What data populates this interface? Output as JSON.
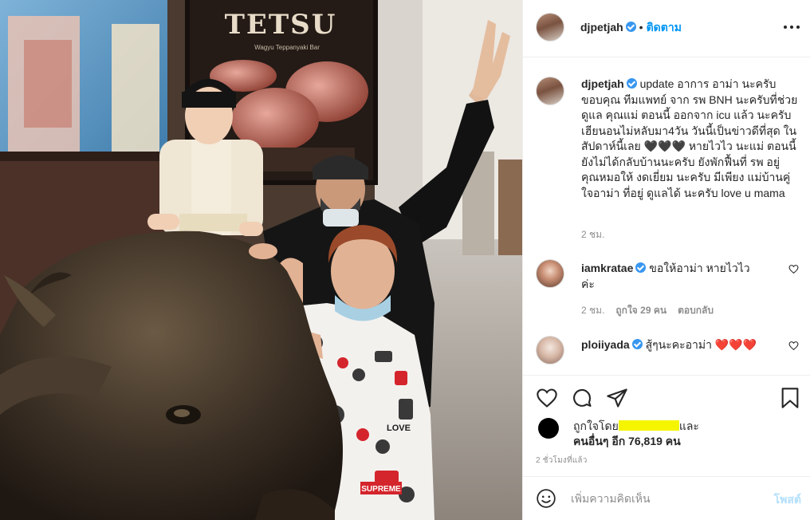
{
  "post": {
    "username": "djpetjah",
    "verified": true,
    "separator": "•",
    "follow_label": "ติดตาม"
  },
  "caption": {
    "username": "djpetjah",
    "text": "update อาการ อาม่า นะครับ ขอบคุณ ทีมแพทย์ จาก รพ BNH นะครับที่ช่วยดูแล คุณแม่ ตอนนี้ ออกจาก icu แล้ว นะครับ เฮียนอนไม่หลับมา4วัน วันนี้เป็นข่าวดีที่สุด ในสัปดาห์นี้เลย 🖤🖤🖤 หายไวไว นะแม่ ตอนนี้ยังไม่ได้กลับบ้านนะครับ ยังพักฟื้นที่ รพ อยู่ คุณหมอให้ งดเยี่ยม นะครับ มีเพียง แม่บ้านคู่ใจอาม่า ที่อยู่ ดูแลได้ นะครับ love u mama",
    "time": "2 ชม."
  },
  "comments": [
    {
      "username": "iamkratae",
      "verified": true,
      "text": "ขอให้อาม่า หายไวไวค่ะ",
      "time": "2 ชม.",
      "likes": "ถูกใจ 29 คน",
      "reply": "ตอบกลับ"
    },
    {
      "username": "ploiiyada",
      "verified": true,
      "text": "สู้ๆนะคะอาม่า",
      "hearts": "❤️❤️❤️"
    }
  ],
  "likes": {
    "prefix": "ถูกใจโดย",
    "suffix": "และ",
    "others": "คนอื่นๆ อีก 76,819 คน"
  },
  "post_time": "2 ชั่วโมงที่แล้ว",
  "add_comment": {
    "placeholder": "เพิ่มความคิดเห็น",
    "post_label": "โพสต์"
  },
  "photo": {
    "sign_text": "TETSU",
    "sign_sub": "Wagyu Teppanyaki Bar",
    "sweater_texts": [
      "SUPREME",
      "LOVE"
    ]
  },
  "colors": {
    "accent": "#0095f6",
    "verified": "#3897f0",
    "heart": "#ed4956",
    "text": "#262626",
    "muted": "#8e8e8e"
  },
  "icons": [
    "more-icon",
    "verified-icon",
    "heart-icon",
    "comment-icon",
    "share-icon",
    "bookmark-icon",
    "emoji-icon"
  ]
}
